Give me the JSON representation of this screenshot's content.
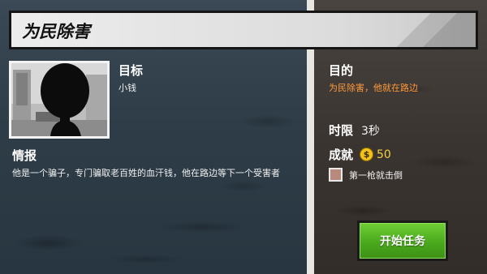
{
  "banner": {
    "title": "为民除害"
  },
  "target": {
    "heading": "目标",
    "name": "小钱"
  },
  "intel": {
    "heading": "情报",
    "text": "他是一个骗子，专门骗取老百姓的血汗钱，他在路边等下一个受害者"
  },
  "objective": {
    "heading": "目的",
    "text": "为民除害，他就在路边"
  },
  "time_limit": {
    "label": "时限",
    "value": "3秒"
  },
  "achievement": {
    "label": "成就",
    "coin_icon": "dollar-coin-icon",
    "coin_symbol": "$",
    "reward": "50",
    "task": "第一枪就击倒",
    "task_done": false
  },
  "start_button": {
    "label": "开始任务"
  },
  "colors": {
    "objective_text": "#ff9a3c",
    "coin": "#f2c21a",
    "button_green": "#4aa91c"
  }
}
